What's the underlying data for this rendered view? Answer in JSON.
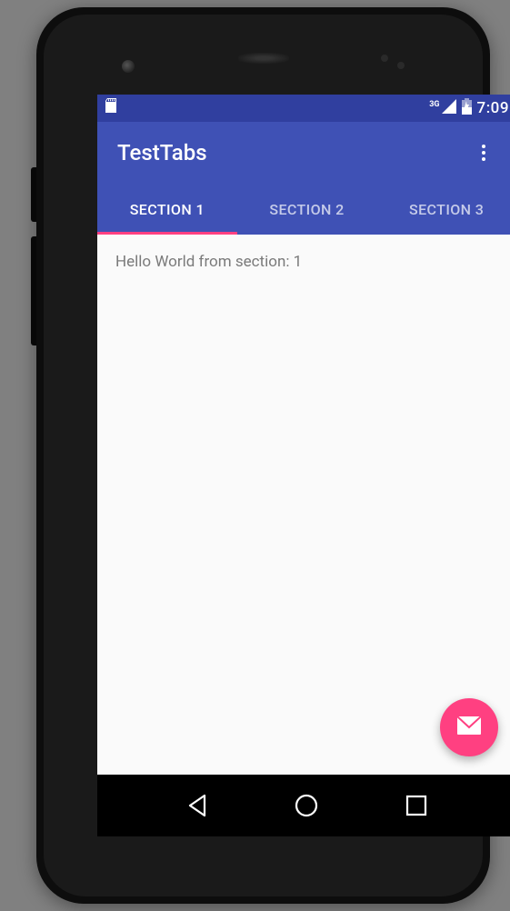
{
  "status": {
    "network_label": "3G",
    "time": "7:09"
  },
  "appbar": {
    "title": "TestTabs"
  },
  "tabs": [
    {
      "label": "SECTION 1",
      "active": true
    },
    {
      "label": "SECTION 2",
      "active": false
    },
    {
      "label": "SECTION 3",
      "active": false
    }
  ],
  "content": {
    "text": "Hello World from section: 1"
  },
  "colors": {
    "primary": "#3F51B5",
    "primary_dark": "#303F9F",
    "accent": "#FF4081"
  }
}
